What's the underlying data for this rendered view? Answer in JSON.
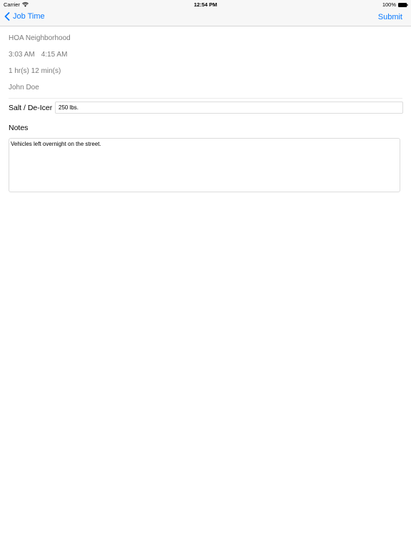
{
  "status_bar": {
    "carrier": "Carrier",
    "time": "12:54 PM",
    "battery": "100%"
  },
  "nav": {
    "back_label": "Job Time",
    "submit_label": "Submit",
    "accent_color": "#0a7aff"
  },
  "job": {
    "location": "HOA Neighborhood",
    "start_time": "3:03 AM",
    "end_time": "4:15 AM",
    "duration": "1 hr(s) 12 min(s)",
    "worker": "John Doe"
  },
  "salt": {
    "label": "Salt / De-Icer",
    "value": "250 lbs."
  },
  "notes": {
    "label": "Notes",
    "value": "Vehicles left overnight on the street."
  },
  "icons": {
    "wifi": "wifi-icon",
    "battery": "battery-icon",
    "back": "chevron-left-icon"
  }
}
